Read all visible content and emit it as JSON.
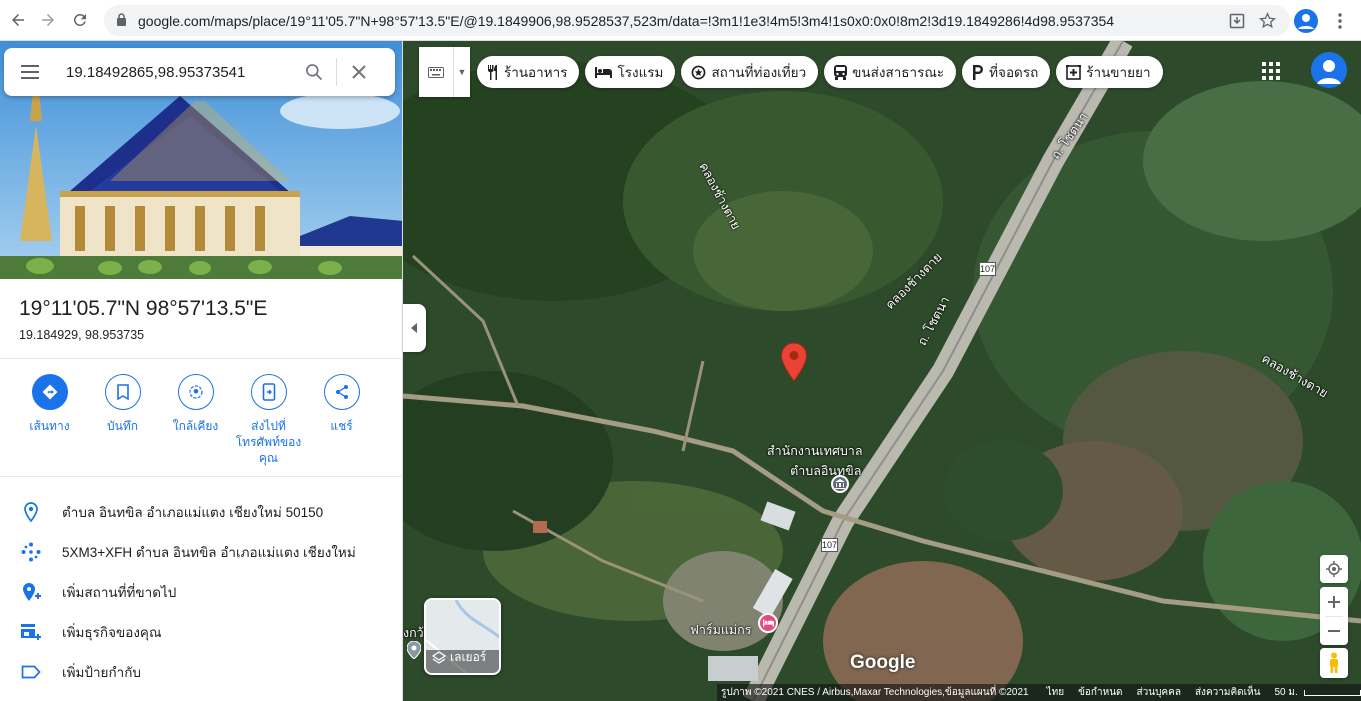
{
  "browser": {
    "url": "google.com/maps/place/19°11'05.7\"N+98°57'13.5\"E/@19.1849906,98.9528537,523m/data=!3m1!1e3!4m5!3m4!1s0x0:0x0!8m2!3d19.1849286!4d98.9537354",
    "back_icon": "arrow-left-icon",
    "forward_icon": "arrow-right-icon",
    "reload_icon": "reload-icon"
  },
  "search": {
    "value": "19.18492865,98.95373541"
  },
  "place": {
    "title": "19°11'05.7\"N 98°57'13.5\"E",
    "decimal": "19.184929, 98.953735"
  },
  "actions": [
    {
      "label": "เส้นทาง",
      "icon": "directions-icon"
    },
    {
      "label": "บันทึก",
      "icon": "bookmark-icon"
    },
    {
      "label": "ใกล้เคียง",
      "icon": "nearby-icon"
    },
    {
      "label": "ส่งไปที่โทรศัพท์ของคุณ",
      "icon": "send-to-phone-icon"
    },
    {
      "label": "แชร์",
      "icon": "share-icon"
    }
  ],
  "info": [
    {
      "text": "ตำบล อินทขิล อำเภอแม่แตง เชียงใหม่ 50150",
      "icon": "location-pin-icon"
    },
    {
      "text": "5XM3+XFH ตำบล อินทขิล อำเภอแม่แตง เชียงใหม่",
      "icon": "plus-code-icon"
    },
    {
      "text": "เพิ่มสถานที่ที่ขาดไป",
      "icon": "add-place-icon"
    },
    {
      "text": "เพิ่มธุรกิจของคุณ",
      "icon": "add-business-icon"
    },
    {
      "text": "เพิ่มป้ายกำกับ",
      "icon": "label-icon"
    }
  ],
  "chips": [
    {
      "label": "ร้านอาหาร",
      "icon": "restaurant-icon"
    },
    {
      "label": "โรงแรม",
      "icon": "hotel-icon"
    },
    {
      "label": "สถานที่ท่องเที่ยว",
      "icon": "attraction-icon"
    },
    {
      "label": "ขนส่งสาธารณะ",
      "icon": "transit-icon"
    },
    {
      "label": "ที่จอดรถ",
      "icon": "parking-icon"
    },
    {
      "label": "ร้านขายยา",
      "icon": "pharmacy-icon"
    }
  ],
  "map": {
    "road_labels": [
      "ถ. โชตนา",
      "ถ. โชตนา"
    ],
    "canal_labels": [
      "คลองช้างตาย",
      "คลองช้างตาย",
      "คลองช้างตาย"
    ],
    "route_shield": "107",
    "poi_office_line1": "สำนักงานเทศบาล",
    "poi_office_line2": "ตำบลอินทขิล",
    "poi_farm": "ฟาร์มแม่กร",
    "edge_label": "งกว้",
    "layers_label": "เลเยอร์",
    "google_logo": "Google"
  },
  "footer": {
    "imagery": "รูปภาพ ©2021 CNES / Airbus,Maxar Technologies,ข้อมูลแผนที่ ©2021",
    "lang": "ไทย",
    "terms": "ข้อกำหนด",
    "privacy": "ส่วนบุคคล",
    "feedback": "ส่งความคิดเห็น",
    "scale": "50 ม."
  },
  "colors": {
    "accent": "#1a73e8",
    "pin": "#ea4335",
    "poi_pink": "#e84a7f"
  }
}
